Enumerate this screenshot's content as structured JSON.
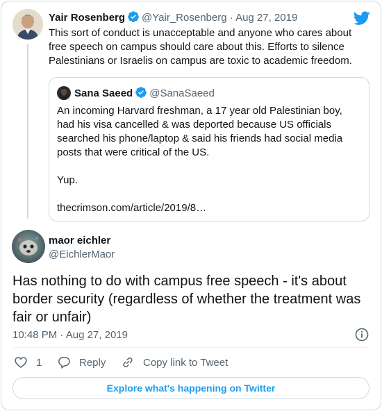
{
  "parent_tweet": {
    "author_name": "Yair Rosenberg",
    "handle": "@Yair_Rosenberg",
    "date": "Aug 27, 2019",
    "separator": "·",
    "text_lines": [
      "This sort of conduct is unacceptable and anyone who cares about",
      "free speech on campus should care about this. Efforts to silence",
      "Palestinians or Israelis on campus are toxic to academic freedom."
    ]
  },
  "quoted_tweet": {
    "author_name": "Sana Saeed",
    "handle": "@SanaSaeed",
    "text_lines": [
      "An incoming Harvard freshman, a 17 year old Palestinian boy,",
      "had his visa cancelled & was deported because US officials",
      "searched his phone/laptop & said his friends had social media",
      "posts that were critical of the US."
    ],
    "yup": "Yup.",
    "link": "thecrimson.com/article/2019/8…"
  },
  "main_tweet": {
    "author_name": "maor eichler",
    "handle": "@EichlerMaor",
    "text": "Has nothing to do with campus free speech - it's about border security (regardless of whether the treatment was fair or unfair)",
    "time": "10:48 PM",
    "separator": "·",
    "date": "Aug 27, 2019"
  },
  "actions": {
    "like_count": "1",
    "reply_label": "Reply",
    "copy_link_label": "Copy link to Tweet"
  },
  "explore_label": "Explore what's happening on Twitter",
  "icons": {
    "brand": "twitter-bird-icon",
    "verified": "verified-badge-icon",
    "info": "info-icon",
    "like": "heart-icon",
    "reply": "reply-bubble-icon",
    "link": "link-icon"
  },
  "colors": {
    "brand_blue": "#1d9bf0",
    "text": "#0f1419",
    "muted": "#536471",
    "border": "#cfd9de"
  }
}
